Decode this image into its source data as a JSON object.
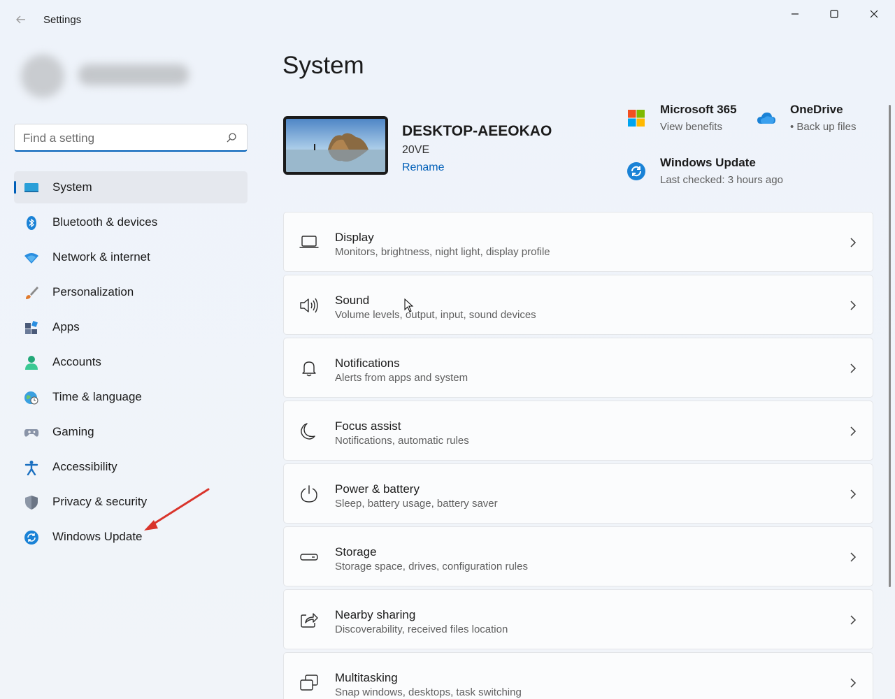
{
  "window": {
    "title": "Settings"
  },
  "search": {
    "placeholder": "Find a setting"
  },
  "sidebar": {
    "items": [
      {
        "label": "System",
        "icon": "system-icon",
        "active": true
      },
      {
        "label": "Bluetooth & devices",
        "icon": "bluetooth-icon"
      },
      {
        "label": "Network & internet",
        "icon": "wifi-icon"
      },
      {
        "label": "Personalization",
        "icon": "brush-icon"
      },
      {
        "label": "Apps",
        "icon": "apps-icon"
      },
      {
        "label": "Accounts",
        "icon": "accounts-icon"
      },
      {
        "label": "Time & language",
        "icon": "globe-clock-icon"
      },
      {
        "label": "Gaming",
        "icon": "gamepad-icon"
      },
      {
        "label": "Accessibility",
        "icon": "accessibility-icon"
      },
      {
        "label": "Privacy & security",
        "icon": "shield-icon"
      },
      {
        "label": "Windows Update",
        "icon": "update-icon"
      }
    ]
  },
  "main": {
    "title": "System",
    "device": {
      "name": "DESKTOP-AEEOKAO",
      "model": "20VE",
      "rename": "Rename"
    },
    "quick_links": [
      {
        "title": "Microsoft 365",
        "subtitle": "View benefits",
        "icon": "microsoft-logo-icon"
      },
      {
        "title": "OneDrive",
        "subtitle": "• Back up files",
        "icon": "onedrive-icon"
      },
      {
        "title": "Windows Update",
        "subtitle": "Last checked: 3 hours ago",
        "icon": "update-icon"
      }
    ],
    "cards": [
      {
        "title": "Display",
        "subtitle": "Monitors, brightness, night light, display profile",
        "icon": "display-icon"
      },
      {
        "title": "Sound",
        "subtitle": "Volume levels, output, input, sound devices",
        "icon": "speaker-icon"
      },
      {
        "title": "Notifications",
        "subtitle": "Alerts from apps and system",
        "icon": "bell-icon"
      },
      {
        "title": "Focus assist",
        "subtitle": "Notifications, automatic rules",
        "icon": "moon-icon"
      },
      {
        "title": "Power & battery",
        "subtitle": "Sleep, battery usage, battery saver",
        "icon": "power-icon"
      },
      {
        "title": "Storage",
        "subtitle": "Storage space, drives, configuration rules",
        "icon": "storage-icon"
      },
      {
        "title": "Nearby sharing",
        "subtitle": "Discoverability, received files location",
        "icon": "share-icon"
      },
      {
        "title": "Multitasking",
        "subtitle": "Snap windows, desktops, task switching",
        "icon": "multitask-icon"
      }
    ]
  },
  "colors": {
    "accent": "#005fb8",
    "annotation_arrow": "#d9342b"
  }
}
